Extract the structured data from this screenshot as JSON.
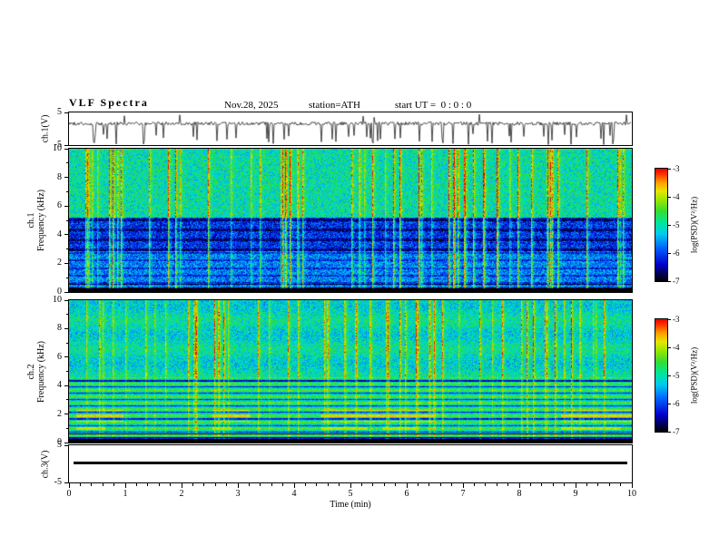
{
  "header": {
    "title": "VLF Spectra",
    "date": "Nov.28, 2025",
    "station": "station=ATH",
    "start_ut": "start UT =  0 : 0 : 0"
  },
  "xaxis": {
    "label": "Time (min)",
    "lim": [
      0,
      10
    ],
    "ticks": [
      0,
      1,
      2,
      3,
      4,
      5,
      6,
      7,
      8,
      9,
      10
    ],
    "minor_tick_step": 0.2
  },
  "colorbar": {
    "label": "log(PSD)(V²/Hz)",
    "lim": [
      -7,
      -3
    ],
    "ticks": [
      -3,
      -4,
      -5,
      -6,
      -7
    ]
  },
  "colormap": [
    [
      0.0,
      "#000000"
    ],
    [
      0.06,
      "#00004d"
    ],
    [
      0.15,
      "#0000cc"
    ],
    [
      0.3,
      "#0066ff"
    ],
    [
      0.42,
      "#00ccee"
    ],
    [
      0.52,
      "#00e699"
    ],
    [
      0.62,
      "#33dd33"
    ],
    [
      0.72,
      "#99e600"
    ],
    [
      0.8,
      "#e6e600"
    ],
    [
      0.88,
      "#ff9900"
    ],
    [
      0.95,
      "#ff3300"
    ],
    [
      1.0,
      "#e60000"
    ]
  ],
  "chart_data": [
    {
      "id": "ch1_waveform",
      "type": "line",
      "ylabel": "ch.1(V)",
      "ylim": [
        -5,
        5
      ],
      "yticks": [
        5,
        -5
      ],
      "xlim": [
        0,
        10
      ],
      "signal": {
        "baseline_v": 1.6,
        "noise_v": 0.5,
        "neg_spike_rate": 0.06,
        "neg_spike_depth_v": -5,
        "pos_spike_rate": 0.012,
        "pos_spike_v": 4.5
      },
      "description": "Continuous noisy voltage trace near +1.6 V with frequent impulsive negative spikes reaching -5 V."
    },
    {
      "id": "ch1_spectrogram",
      "type": "heatmap",
      "ylabel_lines": [
        "ch.1",
        "Frequency (kHz)"
      ],
      "ylim": [
        0,
        10
      ],
      "yticks": [
        0,
        2,
        4,
        6,
        8,
        10
      ],
      "xlim": [
        0,
        10
      ],
      "zlim": [
        -7,
        -3
      ],
      "features": {
        "background_db": -5.0,
        "low_band_db": -5.7,
        "quiet_band_khz": [
          2.9,
          5.2
        ],
        "quiet_band_db": -6.1,
        "dead_band_khz": [
          0,
          0.3
        ],
        "event_rate": 0.1,
        "red_speckle_db": -3.5
      },
      "description": "Broadband green/cyan noise 5-10 kHz, dark blue quiet band 3-5 kHz with darker horizontal lines, black band below 0.3 kHz, many full-height yellow/red impulsive vertical stripes (sferics)."
    },
    {
      "id": "ch2_spectrogram",
      "type": "heatmap",
      "ylabel_lines": [
        "ch.2",
        "Frequency (kHz)"
      ],
      "ylim": [
        0,
        10
      ],
      "yticks": [
        0,
        2,
        4,
        6,
        8,
        10
      ],
      "xlim": [
        0,
        10
      ],
      "zlim": [
        -7,
        -3
      ],
      "features": {
        "background_db": -5.1,
        "banded_below_khz": 4.6,
        "band_spacing_khz": 0.45,
        "hot_band_khz": [
          1.5,
          2.3
        ],
        "hot_band2_khz": [
          0.95,
          1.3
        ],
        "hot_band_db": -3.5,
        "dead_band_khz": [
          0,
          0.3
        ],
        "event_rate": 0.09
      },
      "description": "Green broadband noise above ~4.6 kHz with impulsive vertical stripes; horizontally banded harmonic lines below 4.6 kHz with intermittent red/yellow patches near 1-2.3 kHz; black band below 0.3 kHz."
    },
    {
      "id": "ch3_waveform",
      "type": "line",
      "ylabel": "ch.3(V)",
      "ylim": [
        -5,
        5
      ],
      "yticks": [
        5,
        -5
      ],
      "xlim": [
        0,
        10
      ],
      "constant_v": 0,
      "description": "Flat thick black line at 0 V (channel inactive)."
    }
  ]
}
